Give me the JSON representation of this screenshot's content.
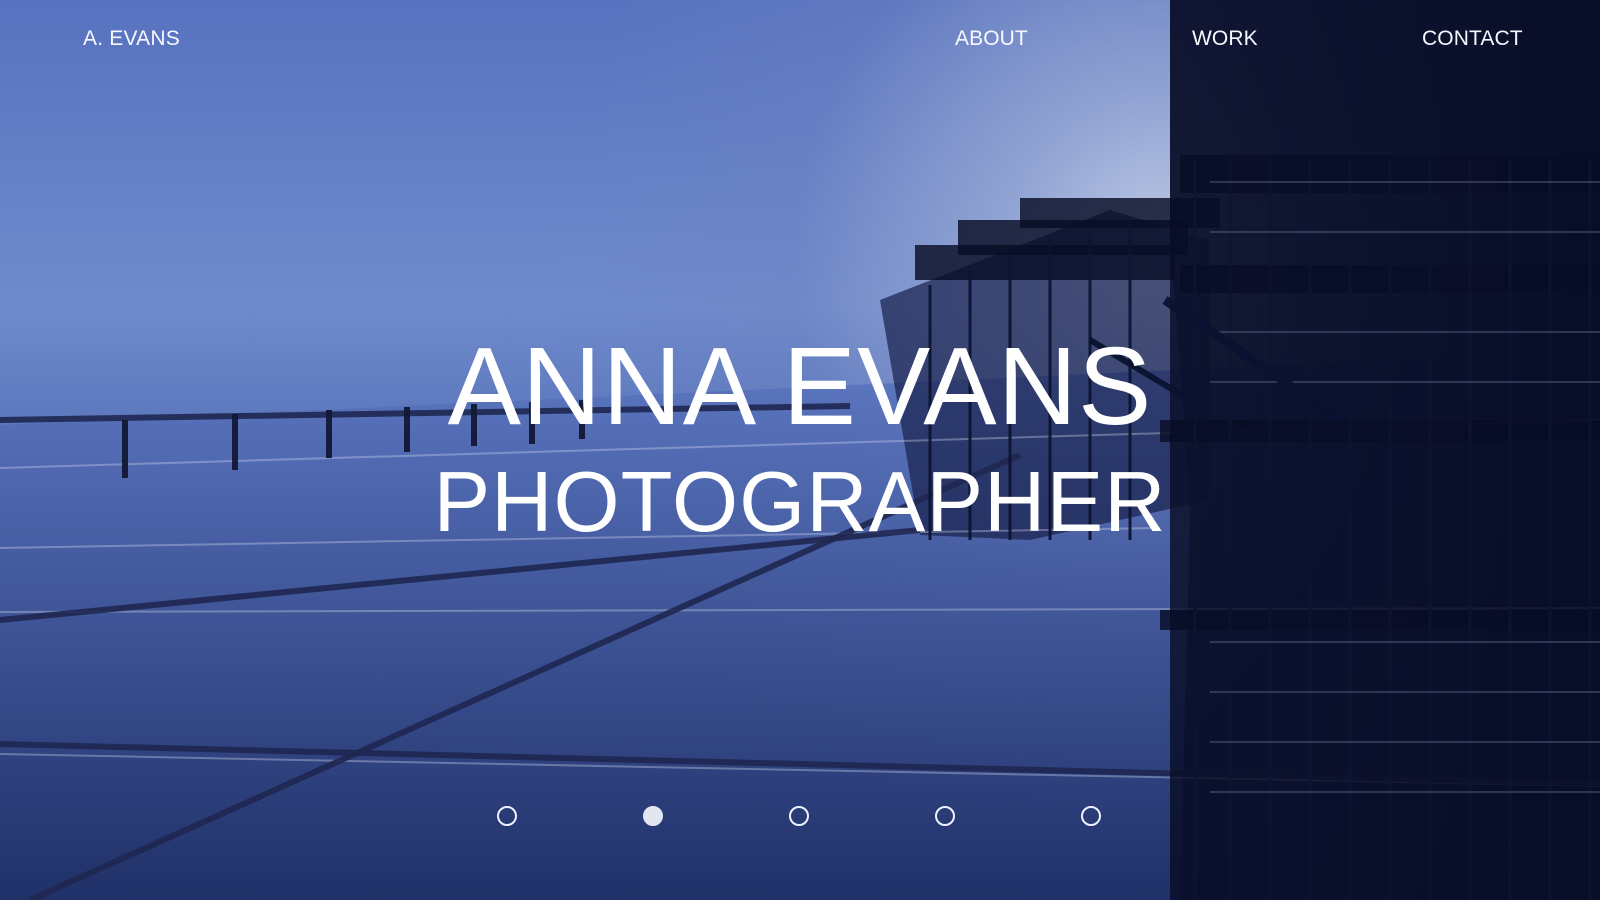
{
  "brand": {
    "label": "A. EVANS"
  },
  "navigation": {
    "items": [
      {
        "label": "ABOUT"
      },
      {
        "label": "WORK"
      },
      {
        "label": "CONTACT"
      }
    ]
  },
  "hero": {
    "name": "ANNA EVANS",
    "role": "PHOTOGRAPHER",
    "slider": {
      "count": 5,
      "active_index": 1
    }
  },
  "colors": {
    "text": "#ffffff",
    "sky": "#6f8bcc",
    "deep_blue": "#1b2450",
    "dot_active": "#e3e6ef"
  }
}
